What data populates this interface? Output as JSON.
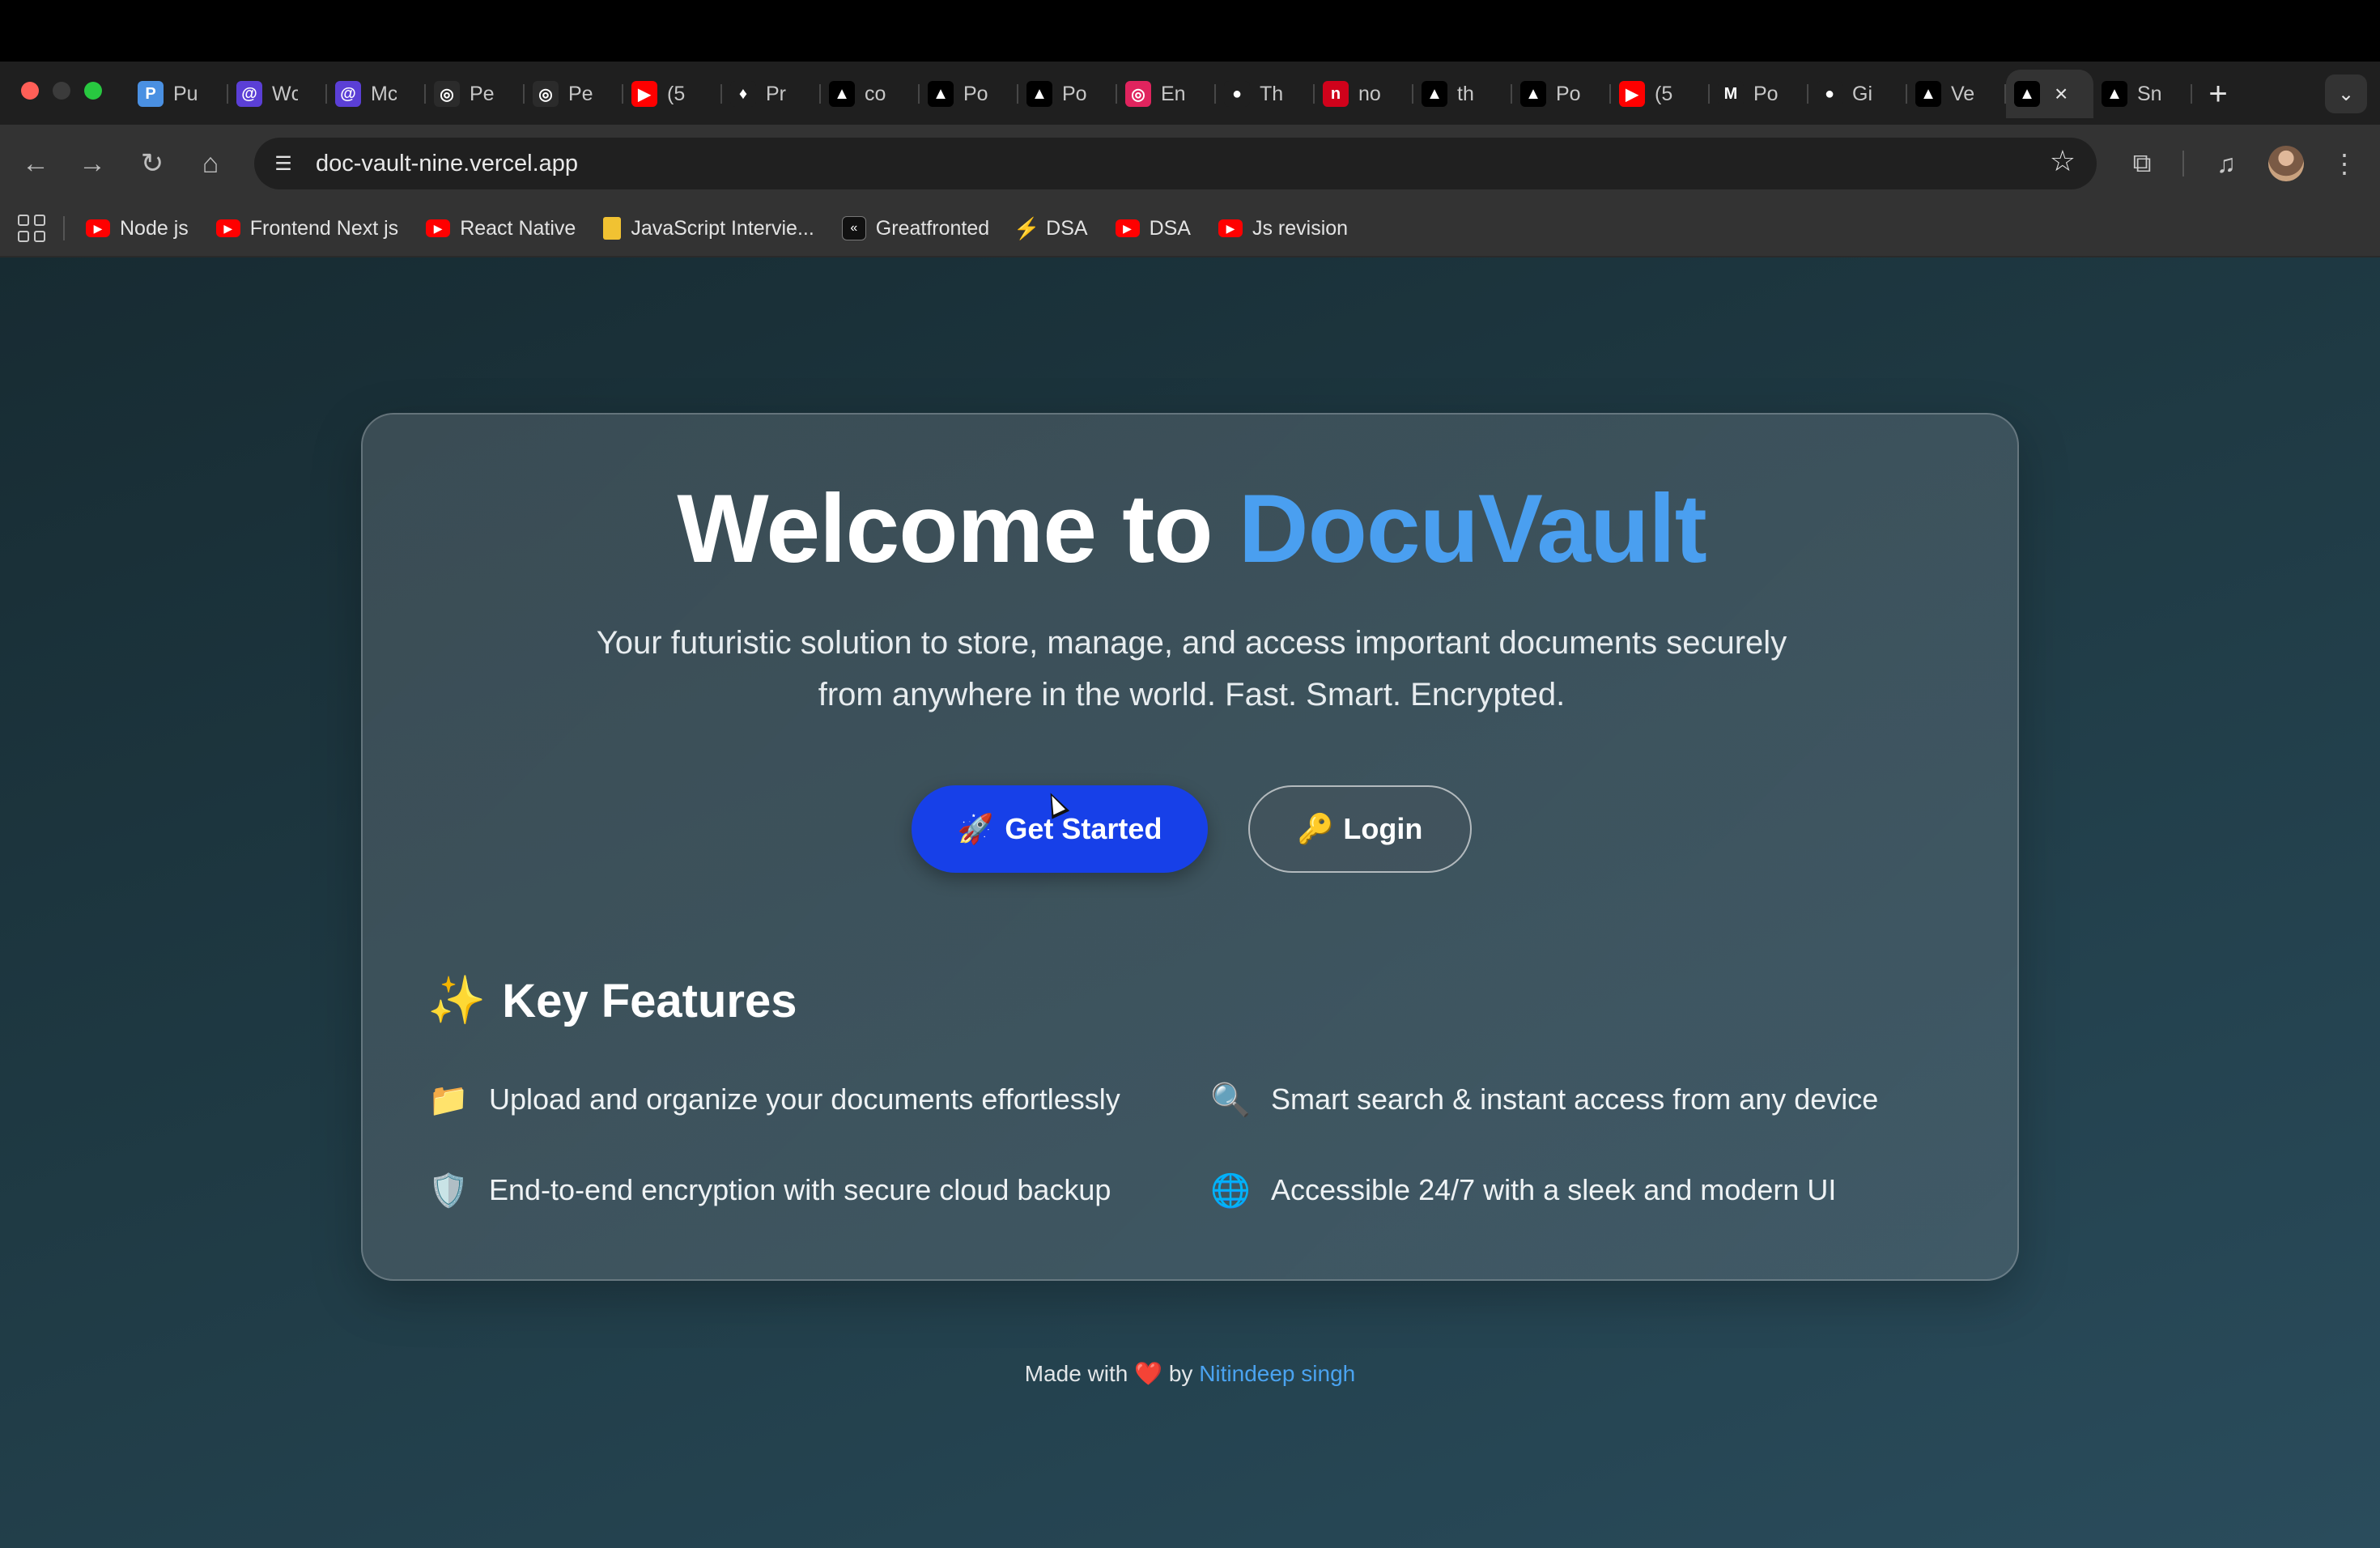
{
  "browser": {
    "tabs": [
      {
        "label": "Pu",
        "icon": "P",
        "color": "#4a90e2"
      },
      {
        "label": "Wc",
        "icon": "@",
        "color": "#5b3fd6"
      },
      {
        "label": "Mc",
        "icon": "@",
        "color": "#5b3fd6"
      },
      {
        "label": "Pe",
        "icon": "◎",
        "color": "#2b2b2b"
      },
      {
        "label": "Pe",
        "icon": "◎",
        "color": "#2b2b2b"
      },
      {
        "label": "(5",
        "icon": "▶",
        "color": "#ff0000"
      },
      {
        "label": "Pr",
        "icon": "♦",
        "color": "#1f1f1f"
      },
      {
        "label": "co",
        "icon": "▲",
        "color": "#000000"
      },
      {
        "label": "Po",
        "icon": "▲",
        "color": "#000000"
      },
      {
        "label": "Po",
        "icon": "▲",
        "color": "#000000"
      },
      {
        "label": "En",
        "icon": "◎",
        "color": "#e0245e"
      },
      {
        "label": "Th",
        "icon": "●",
        "color": "#1f1f1f"
      },
      {
        "label": "no",
        "icon": "n",
        "color": "#d0021b"
      },
      {
        "label": "th",
        "icon": "▲",
        "color": "#000000"
      },
      {
        "label": "Po",
        "icon": "▲",
        "color": "#000000"
      },
      {
        "label": "(5",
        "icon": "▶",
        "color": "#ff0000"
      },
      {
        "label": "Po",
        "icon": "M",
        "color": "#1f1f1f"
      },
      {
        "label": "Gi",
        "icon": "●",
        "color": "#1f1f1f"
      },
      {
        "label": "Ve",
        "icon": "▲",
        "color": "#000000"
      }
    ],
    "active_tab": {
      "icon": "▲",
      "close": "×"
    },
    "after_tab": {
      "label": "Sn",
      "icon": "▲"
    },
    "new_tab": "+",
    "tab_search": "⌄",
    "url": "doc-vault-nine.vercel.app"
  },
  "bookmarks": [
    {
      "label": "Node js",
      "icon": "▶",
      "kind": "yt"
    },
    {
      "label": "Frontend Next js",
      "icon": "▶",
      "kind": "yt"
    },
    {
      "label": "React Native",
      "icon": "▶",
      "kind": "yt"
    },
    {
      "label": "JavaScript Intervie...",
      "icon": "",
      "kind": "note"
    },
    {
      "label": "Greatfronted",
      "icon": "«",
      "kind": "gf"
    },
    {
      "label": "DSA",
      "icon": "⚡",
      "kind": "dsa"
    },
    {
      "label": "DSA",
      "icon": "▶",
      "kind": "yt"
    },
    {
      "label": "Js revision",
      "icon": "▶",
      "kind": "yt"
    }
  ],
  "hero": {
    "title_prefix": "Welcome to ",
    "title_brand": "DocuVault",
    "subtitle": "Your futuristic solution to store, manage, and access important documents securely from anywhere in the world. Fast. Smart. Encrypted."
  },
  "actions": {
    "start_icon": "🚀",
    "start_label": "Get Started",
    "login_icon": "🔑",
    "login_label": "Login"
  },
  "features": {
    "title_icon": "✨",
    "title": "Key Features",
    "items": [
      {
        "icon": "📁",
        "text": "Upload and organize your documents effortlessly"
      },
      {
        "icon": "🔍",
        "text": "Smart search & instant access from any device"
      },
      {
        "icon": "🛡️",
        "text": "End-to-end encryption with secure cloud backup"
      },
      {
        "icon": "🌐",
        "text": "Accessible 24/7 with a sleek and modern UI"
      }
    ]
  },
  "footer": {
    "prefix": "Made with",
    "heart": "❤️",
    "by": "by",
    "author": "Nitindeep singh"
  }
}
